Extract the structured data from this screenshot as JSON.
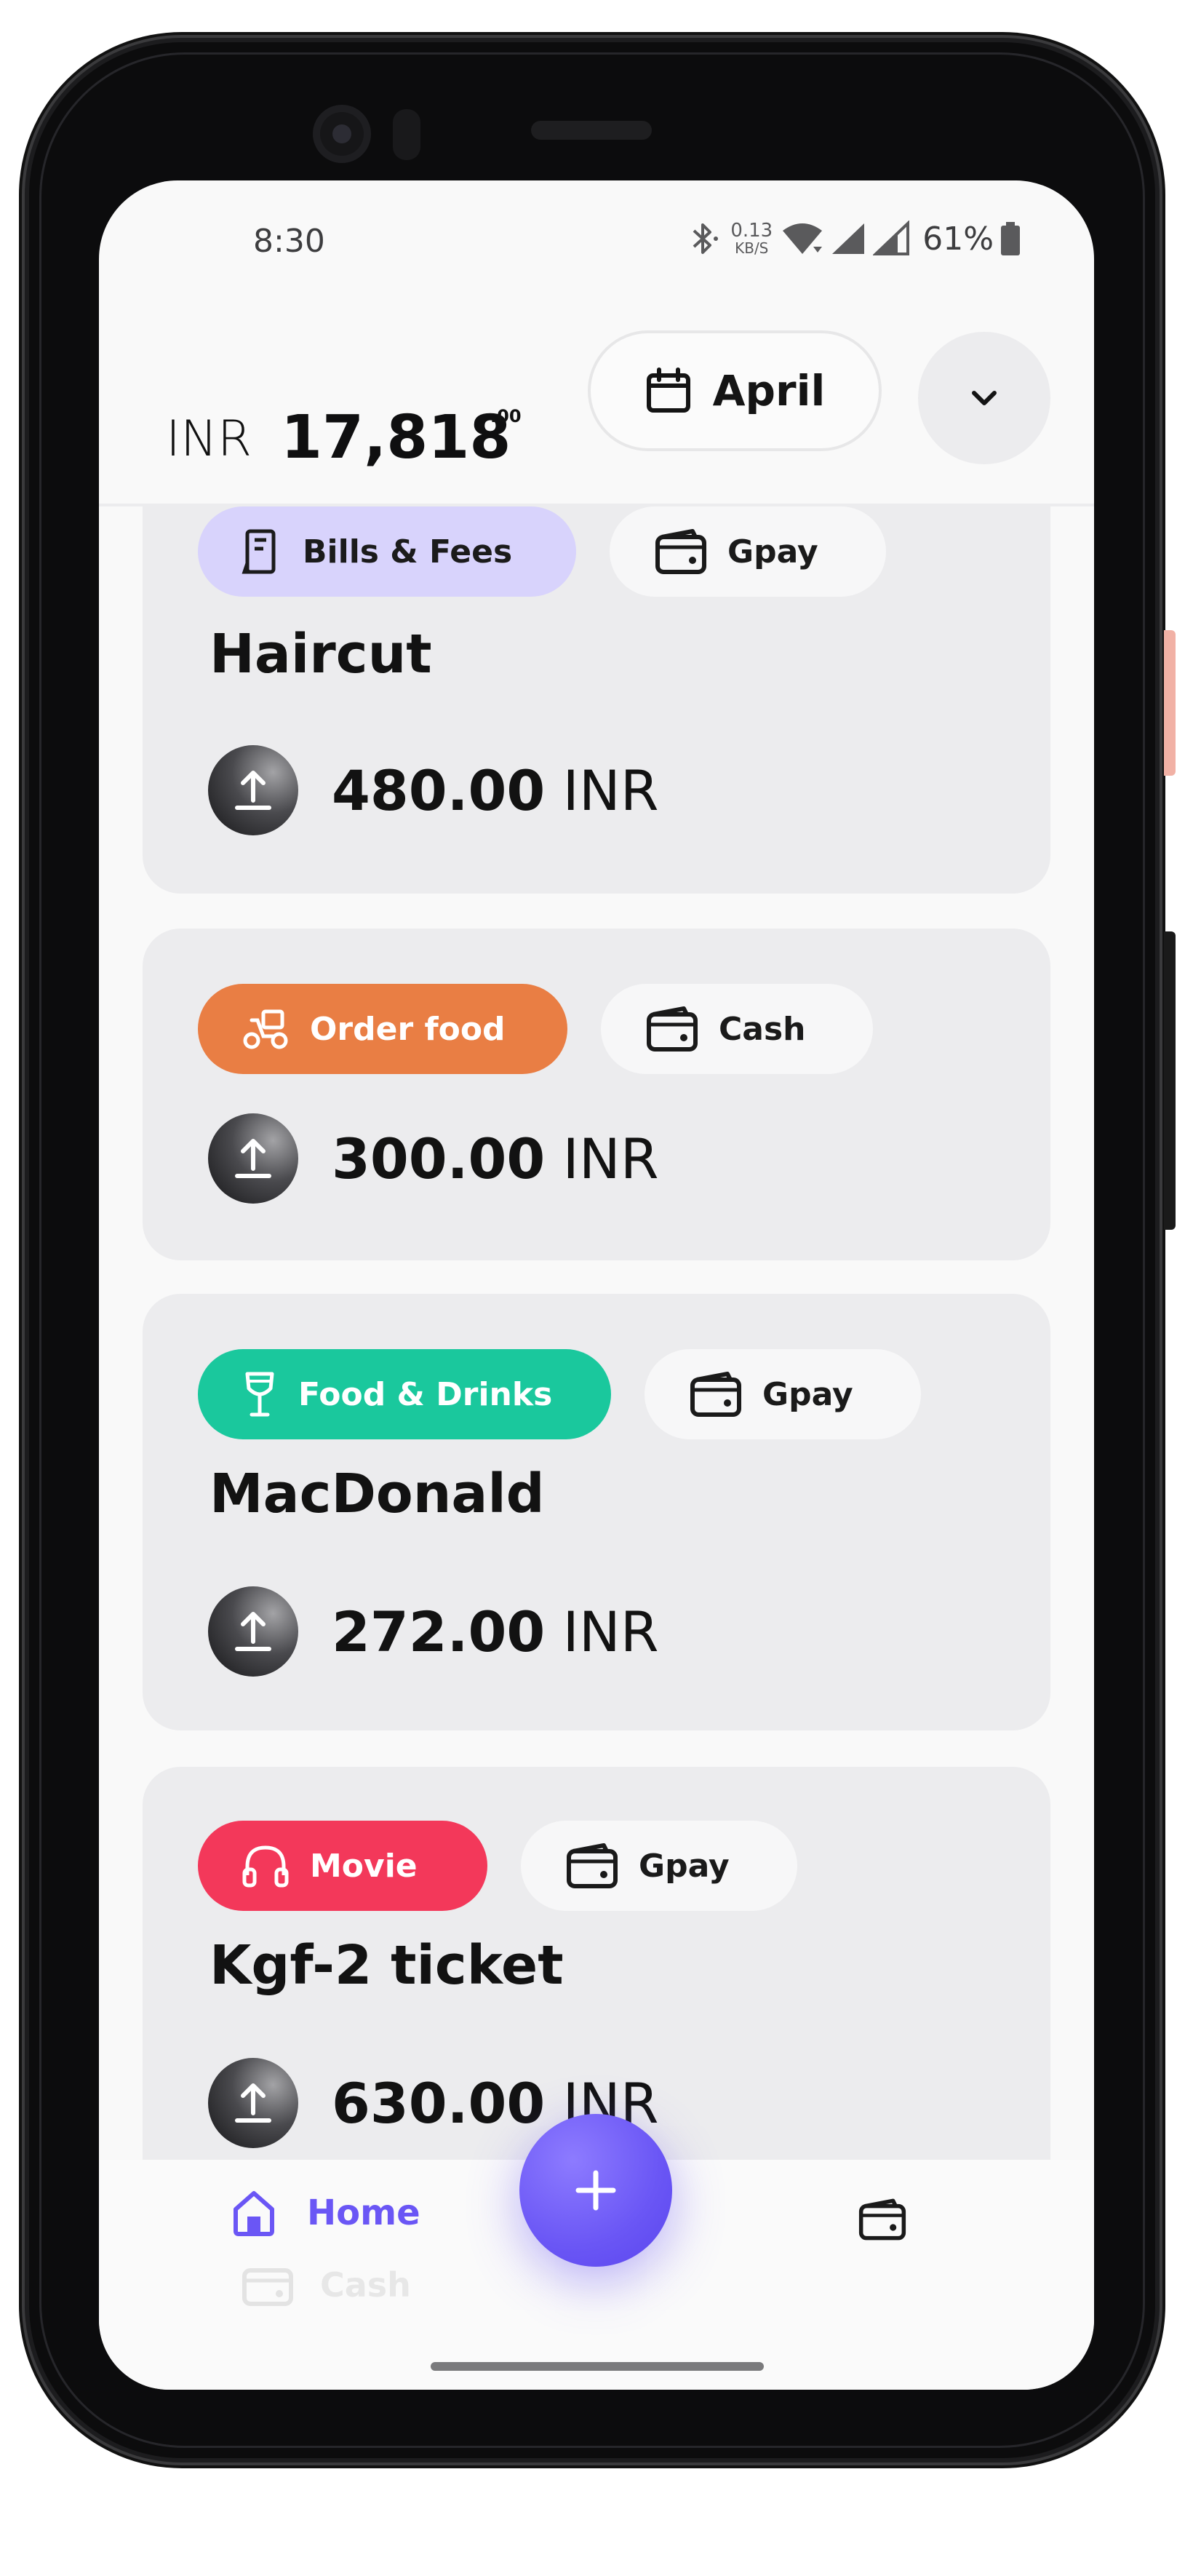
{
  "status_bar": {
    "time": "8:30",
    "net_speed_value": "0.13",
    "net_speed_unit": "KB/S",
    "battery_percent": "61%"
  },
  "header": {
    "currency": "INR",
    "balance": "17,818",
    "balance_cents": ".00",
    "month": "April"
  },
  "transactions": [
    {
      "category": "Bills & Fees",
      "category_color": "#d8d3fc",
      "category_text_color": "#1b1b1b",
      "category_icon": "receipt-icon",
      "wallet": "Gpay",
      "title": "Haircut",
      "amount": "480.00",
      "currency": "INR"
    },
    {
      "category": "Order food",
      "category_color": "#e97e44",
      "category_text_color": "#ffffff",
      "category_icon": "delivery-scooter-icon",
      "wallet": "Cash",
      "title": "",
      "amount": "300.00",
      "currency": "INR"
    },
    {
      "category": "Food & Drinks",
      "category_color": "#1ac89d",
      "category_text_color": "#ffffff",
      "category_icon": "wine-glass-icon",
      "wallet": "Gpay",
      "title": "MacDonald",
      "amount": "272.00",
      "currency": "INR"
    },
    {
      "category": "Movie",
      "category_color": "#f3385a",
      "category_text_color": "#ffffff",
      "category_icon": "headphones-icon",
      "wallet": "Gpay",
      "title": "Kgf-2 ticket",
      "amount": "630.00",
      "currency": "INR"
    }
  ],
  "bottom_nav": {
    "home_label": "Home",
    "cash_label": "Cash",
    "accent_color": "#6a56f5"
  }
}
